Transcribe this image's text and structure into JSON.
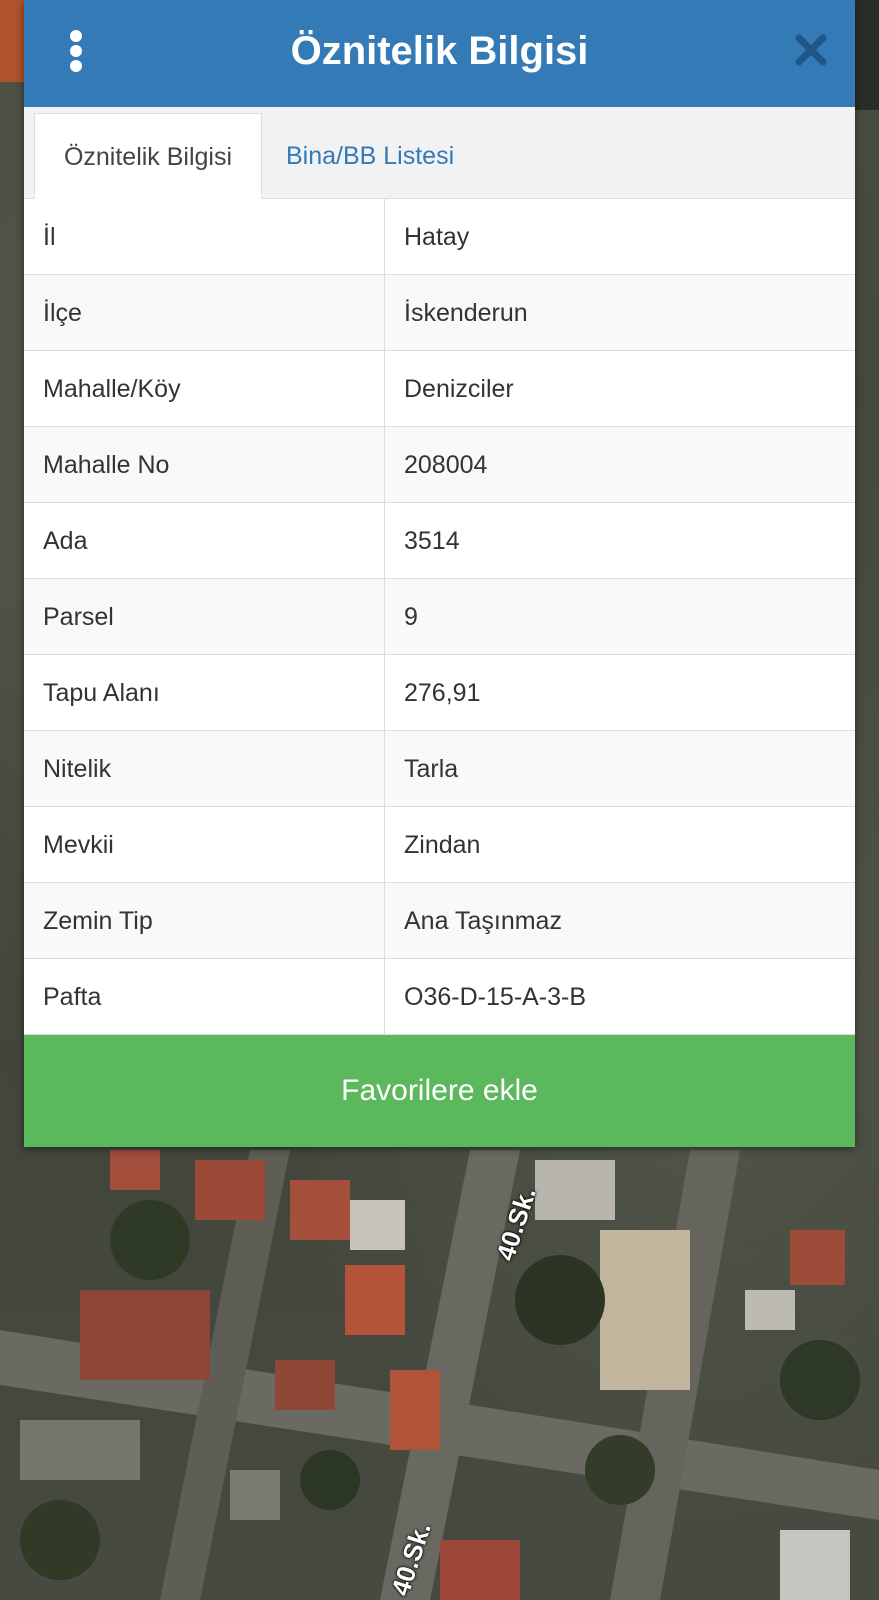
{
  "header": {
    "title": "Öznitelik Bilgisi"
  },
  "tabs": [
    {
      "label": "Öznitelik Bilgisi",
      "active": true
    },
    {
      "label": "Bina/BB Listesi",
      "active": false
    }
  ],
  "rows": [
    {
      "label": "İl",
      "value": "Hatay"
    },
    {
      "label": "İlçe",
      "value": "İskenderun"
    },
    {
      "label": "Mahalle/Köy",
      "value": "Denizciler"
    },
    {
      "label": "Mahalle No",
      "value": "208004"
    },
    {
      "label": "Ada",
      "value": "3514"
    },
    {
      "label": "Parsel",
      "value": "9"
    },
    {
      "label": "Tapu Alanı",
      "value": "276,91"
    },
    {
      "label": "Nitelik",
      "value": "Tarla"
    },
    {
      "label": "Mevkii",
      "value": "Zindan"
    },
    {
      "label": "Zemin Tip",
      "value": "Ana Taşınmaz"
    },
    {
      "label": "Pafta",
      "value": "O36-D-15-A-3-B"
    }
  ],
  "favorite_button": {
    "label": "Favorilere ekle"
  },
  "map": {
    "street_label_1": "40.Sk.",
    "street_label_2": "40.Sk."
  },
  "icons": {
    "menu": "more-vertical-icon",
    "close": "close-icon"
  },
  "colors": {
    "header_bg": "#337ab7",
    "tab_link": "#337ab7",
    "button_bg": "#5cb85c",
    "row_alt_bg": "#f9f9f9",
    "border": "#dddddd"
  }
}
